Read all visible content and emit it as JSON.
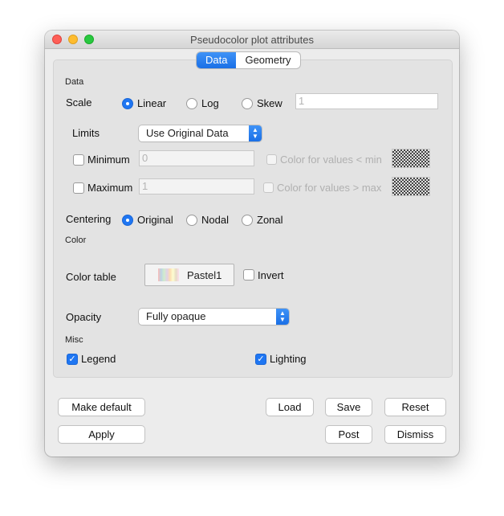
{
  "window": {
    "title": "Pseudocolor plot attributes"
  },
  "tabs": [
    {
      "label": "Data",
      "active": true
    },
    {
      "label": "Geometry",
      "active": false
    }
  ],
  "data_section": {
    "section_label": "Data",
    "scale": {
      "label": "Scale",
      "options": [
        "Linear",
        "Log",
        "Skew"
      ],
      "selected": "Linear",
      "skew_value": "1"
    },
    "limits": {
      "label": "Limits",
      "mode": "Use Original Data"
    },
    "minimum": {
      "label": "Minimum",
      "checked": false,
      "value": "0",
      "color_label": "Color for values < min"
    },
    "maximum": {
      "label": "Maximum",
      "checked": false,
      "value": "1",
      "color_label": "Color for values > max"
    },
    "centering": {
      "label": "Centering",
      "options": [
        "Original",
        "Nodal",
        "Zonal"
      ],
      "selected": "Original"
    }
  },
  "color_section": {
    "section_label": "Color",
    "color_table_label": "Color table",
    "color_table_value": "Pastel1",
    "invert_label": "Invert",
    "invert_checked": false,
    "opacity_label": "Opacity",
    "opacity_value": "Fully opaque"
  },
  "misc_section": {
    "section_label": "Misc",
    "legend_label": "Legend",
    "legend_checked": true,
    "lighting_label": "Lighting",
    "lighting_checked": true
  },
  "buttons": {
    "make_default": "Make default",
    "load": "Load",
    "save": "Save",
    "reset": "Reset",
    "apply": "Apply",
    "post": "Post",
    "dismiss": "Dismiss"
  },
  "colors": {
    "accent": "#1f76f2",
    "window_bg": "#ececec",
    "panel_bg": "#e3e3e3"
  }
}
